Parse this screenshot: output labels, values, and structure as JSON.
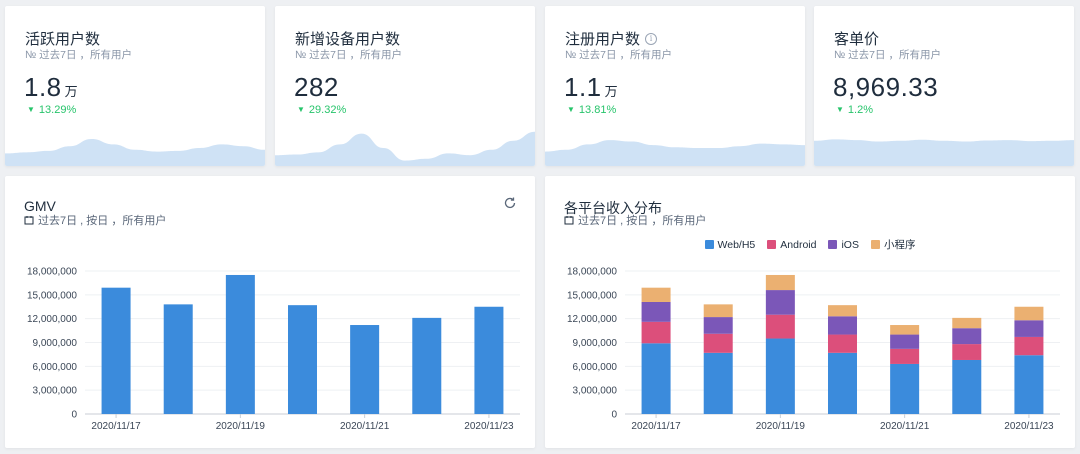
{
  "kpis": [
    {
      "title": "活跃用户数",
      "subtitle": "№ 过去7日 ，所有用户",
      "value": "1.8",
      "unit": "万",
      "change": "13.29%",
      "direction": "down",
      "has_info": false,
      "spark": [
        0.35,
        0.38,
        0.42,
        0.55,
        0.75,
        0.6,
        0.45,
        0.4,
        0.42,
        0.5,
        0.6,
        0.55,
        0.45
      ]
    },
    {
      "title": "新增设备用户数",
      "subtitle": "№ 过去7日 ，所有用户",
      "value": "282",
      "unit": "",
      "change": "29.32%",
      "direction": "down",
      "has_info": false,
      "spark": [
        0.3,
        0.32,
        0.38,
        0.6,
        0.9,
        0.5,
        0.15,
        0.2,
        0.35,
        0.3,
        0.45,
        0.7,
        0.95
      ]
    },
    {
      "title": "注册用户数",
      "subtitle": "№ 过去7日 ，所有用户",
      "value": "1.1",
      "unit": "万",
      "change": "13.81%",
      "direction": "down",
      "has_info": true,
      "spark": [
        0.4,
        0.45,
        0.6,
        0.72,
        0.68,
        0.58,
        0.52,
        0.5,
        0.5,
        0.55,
        0.62,
        0.6,
        0.58
      ]
    },
    {
      "title": "客单价",
      "subtitle": "№ 过去7日 ，所有用户",
      "value": "8,969.33",
      "unit": "",
      "change": "1.2%",
      "direction": "down",
      "has_info": false,
      "spark": [
        0.7,
        0.74,
        0.72,
        0.68,
        0.7,
        0.73,
        0.7,
        0.68,
        0.71,
        0.72,
        0.69,
        0.7,
        0.72
      ]
    }
  ],
  "gmv_card": {
    "title": "GMV",
    "subtitle": "过去7日 , 按日 ，所有用户"
  },
  "platform_card": {
    "title": "各平台收入分布",
    "subtitle": "过去7日 , 按日 ，所有用户"
  },
  "colors": {
    "bar": "#3b8bdc",
    "web": "#3b8bdc",
    "android": "#dc4f7b",
    "ios": "#7b57b8",
    "mini": "#ebb071",
    "positive": "#27c46b",
    "spark": "#cfe2f5"
  },
  "chart_data": [
    {
      "type": "bar",
      "categories": [
        "2020/11/17",
        "2020/11/18",
        "2020/11/19",
        "2020/11/20",
        "2020/11/21",
        "2020/11/22",
        "2020/11/23"
      ],
      "tick_labels_shown": [
        "2020/11/17",
        "",
        "2020/11/19",
        "",
        "2020/11/21",
        "",
        "2020/11/23"
      ],
      "values": [
        15900000,
        13800000,
        17500000,
        13700000,
        11200000,
        12100000,
        13500000
      ],
      "yticks": [
        "0",
        "3,000,000",
        "6,000,000",
        "9,000,000",
        "12,000,000",
        "15,000,000",
        "18,000,000"
      ],
      "ylim": [
        0,
        18000000
      ],
      "grid": true
    },
    {
      "type": "bar",
      "stacked": true,
      "categories": [
        "2020/11/17",
        "2020/11/18",
        "2020/11/19",
        "2020/11/20",
        "2020/11/21",
        "2020/11/22",
        "2020/11/23"
      ],
      "tick_labels_shown": [
        "2020/11/17",
        "",
        "2020/11/19",
        "",
        "2020/11/21",
        "",
        "2020/11/23"
      ],
      "series": [
        {
          "name": "Web/H5",
          "values": [
            8900000,
            7700000,
            9500000,
            7700000,
            6300000,
            6800000,
            7400000
          ]
        },
        {
          "name": "Android",
          "values": [
            2700000,
            2400000,
            3000000,
            2300000,
            1900000,
            2000000,
            2300000
          ]
        },
        {
          "name": "iOS",
          "values": [
            2500000,
            2100000,
            3100000,
            2300000,
            1800000,
            2000000,
            2100000
          ]
        },
        {
          "name": "小程序",
          "values": [
            1800000,
            1600000,
            1900000,
            1400000,
            1200000,
            1300000,
            1700000
          ]
        }
      ],
      "yticks": [
        "0",
        "3,000,000",
        "6,000,000",
        "9,000,000",
        "12,000,000",
        "15,000,000",
        "18,000,000"
      ],
      "ylim": [
        0,
        18000000
      ],
      "legend": "top-center",
      "grid": true
    }
  ]
}
